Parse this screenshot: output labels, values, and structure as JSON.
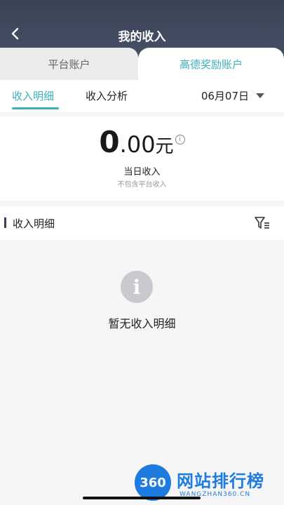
{
  "header": {
    "title": "我的收入",
    "back_icon": "chevron-left-icon"
  },
  "account_tabs": [
    {
      "label": "平台账户",
      "active": false
    },
    {
      "label": "高德奖励账户",
      "active": true
    }
  ],
  "sub_tabs": {
    "income_detail": "收入明细",
    "income_analysis": "收入分析",
    "date": "06月07日"
  },
  "summary": {
    "amount_int": "0",
    "amount_dec": ".00",
    "unit": "元",
    "label": "当日收入",
    "note": "不包含平台收入"
  },
  "detail": {
    "title": "收入明细",
    "empty_text": "暂无收入明细"
  },
  "watermark": {
    "badge": "360",
    "title": "网站排行榜",
    "sub": "WANGZHAN360.CN"
  },
  "colors": {
    "accent": "#3bb0b8",
    "header_bg": "#3a4256"
  }
}
